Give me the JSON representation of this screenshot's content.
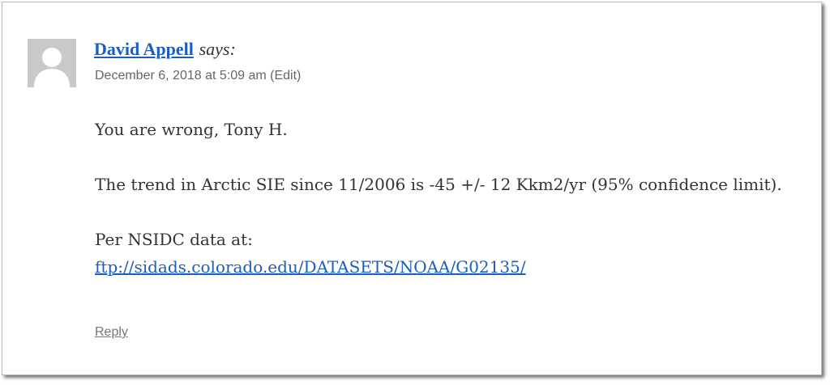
{
  "comment": {
    "author": "David Appell",
    "says": "says:",
    "date": "December 6, 2018 at 5:09 am",
    "edit_label": "(Edit)",
    "paragraphs": {
      "p1": "You are wrong, Tony H.",
      "p2": "The trend in Arctic SIE since 11/2006 is -45 +/- 12 Kkm2/yr (95% confidence limit).",
      "p3_text": "Per NSIDC data at:",
      "p3_link": "ftp://sidads.colorado.edu/DATASETS/NOAA/G02135/"
    },
    "reply_label": "Reply",
    "avatar_icon": "default-user-avatar-icon"
  },
  "colors": {
    "link": "#1a5fbf",
    "text": "#333333",
    "meta": "#666666",
    "avatar_bg": "#c9c9c9"
  }
}
